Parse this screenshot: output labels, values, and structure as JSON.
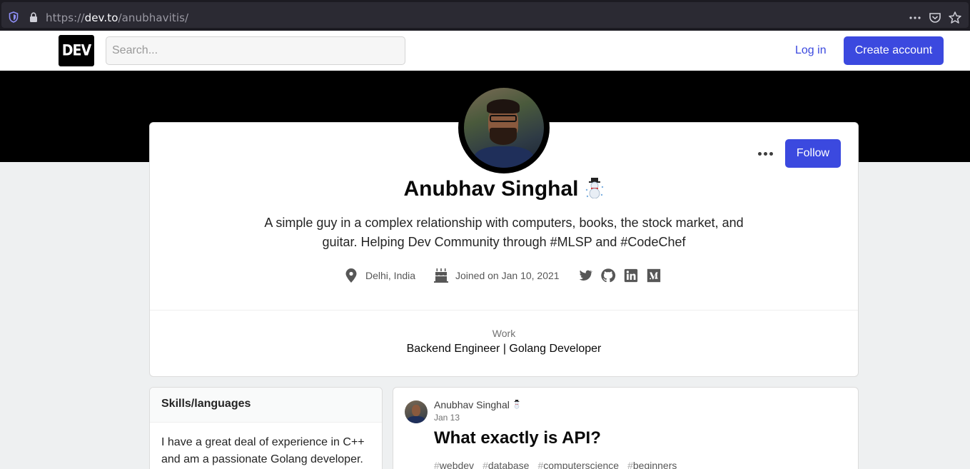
{
  "browser": {
    "url_scheme": "https://",
    "url_host": "dev.to",
    "url_path": "/anubhavitis/"
  },
  "header": {
    "logo": "DEV",
    "search_placeholder": "Search...",
    "login_label": "Log in",
    "create_account_label": "Create account"
  },
  "profile": {
    "name": "Anubhav Singhal",
    "name_emoji": "snowman-icon",
    "bio": "A simple guy in a complex relationship with computers, books, the stock market, and guitar. Helping Dev Community through #MLSP and #CodeChef",
    "location": "Delhi, India",
    "joined": "Joined on Jan 10, 2021",
    "follow_label": "Follow",
    "social": [
      "twitter-icon",
      "github-icon",
      "linkedin-icon",
      "medium-icon"
    ],
    "work_label": "Work",
    "work_value": "Backend Engineer | Golang Developer"
  },
  "skills": {
    "heading": "Skills/languages",
    "body": "I have a great deal of experience in C++ and am a passionate Golang developer."
  },
  "post": {
    "author": "Anubhav Singhal",
    "date": "Jan 13",
    "title": "What exactly is API?",
    "tags": [
      "webdev",
      "database",
      "computerscience",
      "beginners"
    ]
  },
  "colors": {
    "accent": "#3b49df",
    "banner": "#000000",
    "background": "#eef0f1"
  }
}
